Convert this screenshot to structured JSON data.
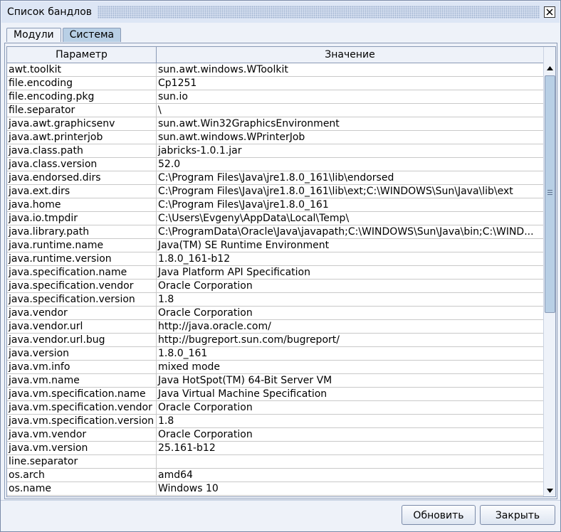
{
  "window": {
    "title": "Список бандлов"
  },
  "tabs": [
    {
      "label": "Модули",
      "active": false
    },
    {
      "label": "Система",
      "active": true
    }
  ],
  "table": {
    "headers": [
      "Параметр",
      "Значение"
    ],
    "rows": [
      [
        "awt.toolkit",
        "sun.awt.windows.WToolkit"
      ],
      [
        "file.encoding",
        "Cp1251"
      ],
      [
        "file.encoding.pkg",
        "sun.io"
      ],
      [
        "file.separator",
        "\\"
      ],
      [
        "java.awt.graphicsenv",
        "sun.awt.Win32GraphicsEnvironment"
      ],
      [
        "java.awt.printerjob",
        "sun.awt.windows.WPrinterJob"
      ],
      [
        "java.class.path",
        "jabricks-1.0.1.jar"
      ],
      [
        "java.class.version",
        "52.0"
      ],
      [
        "java.endorsed.dirs",
        "C:\\Program Files\\Java\\jre1.8.0_161\\lib\\endorsed"
      ],
      [
        "java.ext.dirs",
        "C:\\Program Files\\Java\\jre1.8.0_161\\lib\\ext;C:\\WINDOWS\\Sun\\Java\\lib\\ext"
      ],
      [
        "java.home",
        "C:\\Program Files\\Java\\jre1.8.0_161"
      ],
      [
        "java.io.tmpdir",
        "C:\\Users\\Evgeny\\AppData\\Local\\Temp\\"
      ],
      [
        "java.library.path",
        "C:\\ProgramData\\Oracle\\Java\\javapath;C:\\WINDOWS\\Sun\\Java\\bin;C:\\WIND..."
      ],
      [
        "java.runtime.name",
        "Java(TM) SE Runtime Environment"
      ],
      [
        "java.runtime.version",
        "1.8.0_161-b12"
      ],
      [
        "java.specification.name",
        "Java Platform API Specification"
      ],
      [
        "java.specification.vendor",
        "Oracle Corporation"
      ],
      [
        "java.specification.version",
        "1.8"
      ],
      [
        "java.vendor",
        "Oracle Corporation"
      ],
      [
        "java.vendor.url",
        "http://java.oracle.com/"
      ],
      [
        "java.vendor.url.bug",
        "http://bugreport.sun.com/bugreport/"
      ],
      [
        "java.version",
        "1.8.0_161"
      ],
      [
        "java.vm.info",
        "mixed mode"
      ],
      [
        "java.vm.name",
        "Java HotSpot(TM) 64-Bit Server VM"
      ],
      [
        "java.vm.specification.name",
        "Java Virtual Machine Specification"
      ],
      [
        "java.vm.specification.vendor",
        "Oracle Corporation"
      ],
      [
        "java.vm.specification.version",
        "1.8"
      ],
      [
        "java.vm.vendor",
        "Oracle Corporation"
      ],
      [
        "java.vm.version",
        "25.161-b12"
      ],
      [
        "line.separator",
        ""
      ],
      [
        "os.arch",
        "amd64"
      ],
      [
        "os.name",
        "Windows 10"
      ]
    ]
  },
  "buttons": {
    "refresh": "Обновить",
    "close": "Закрыть"
  },
  "icons": {
    "close": "close-icon",
    "up": "arrow-up-icon",
    "down": "arrow-down-icon"
  }
}
